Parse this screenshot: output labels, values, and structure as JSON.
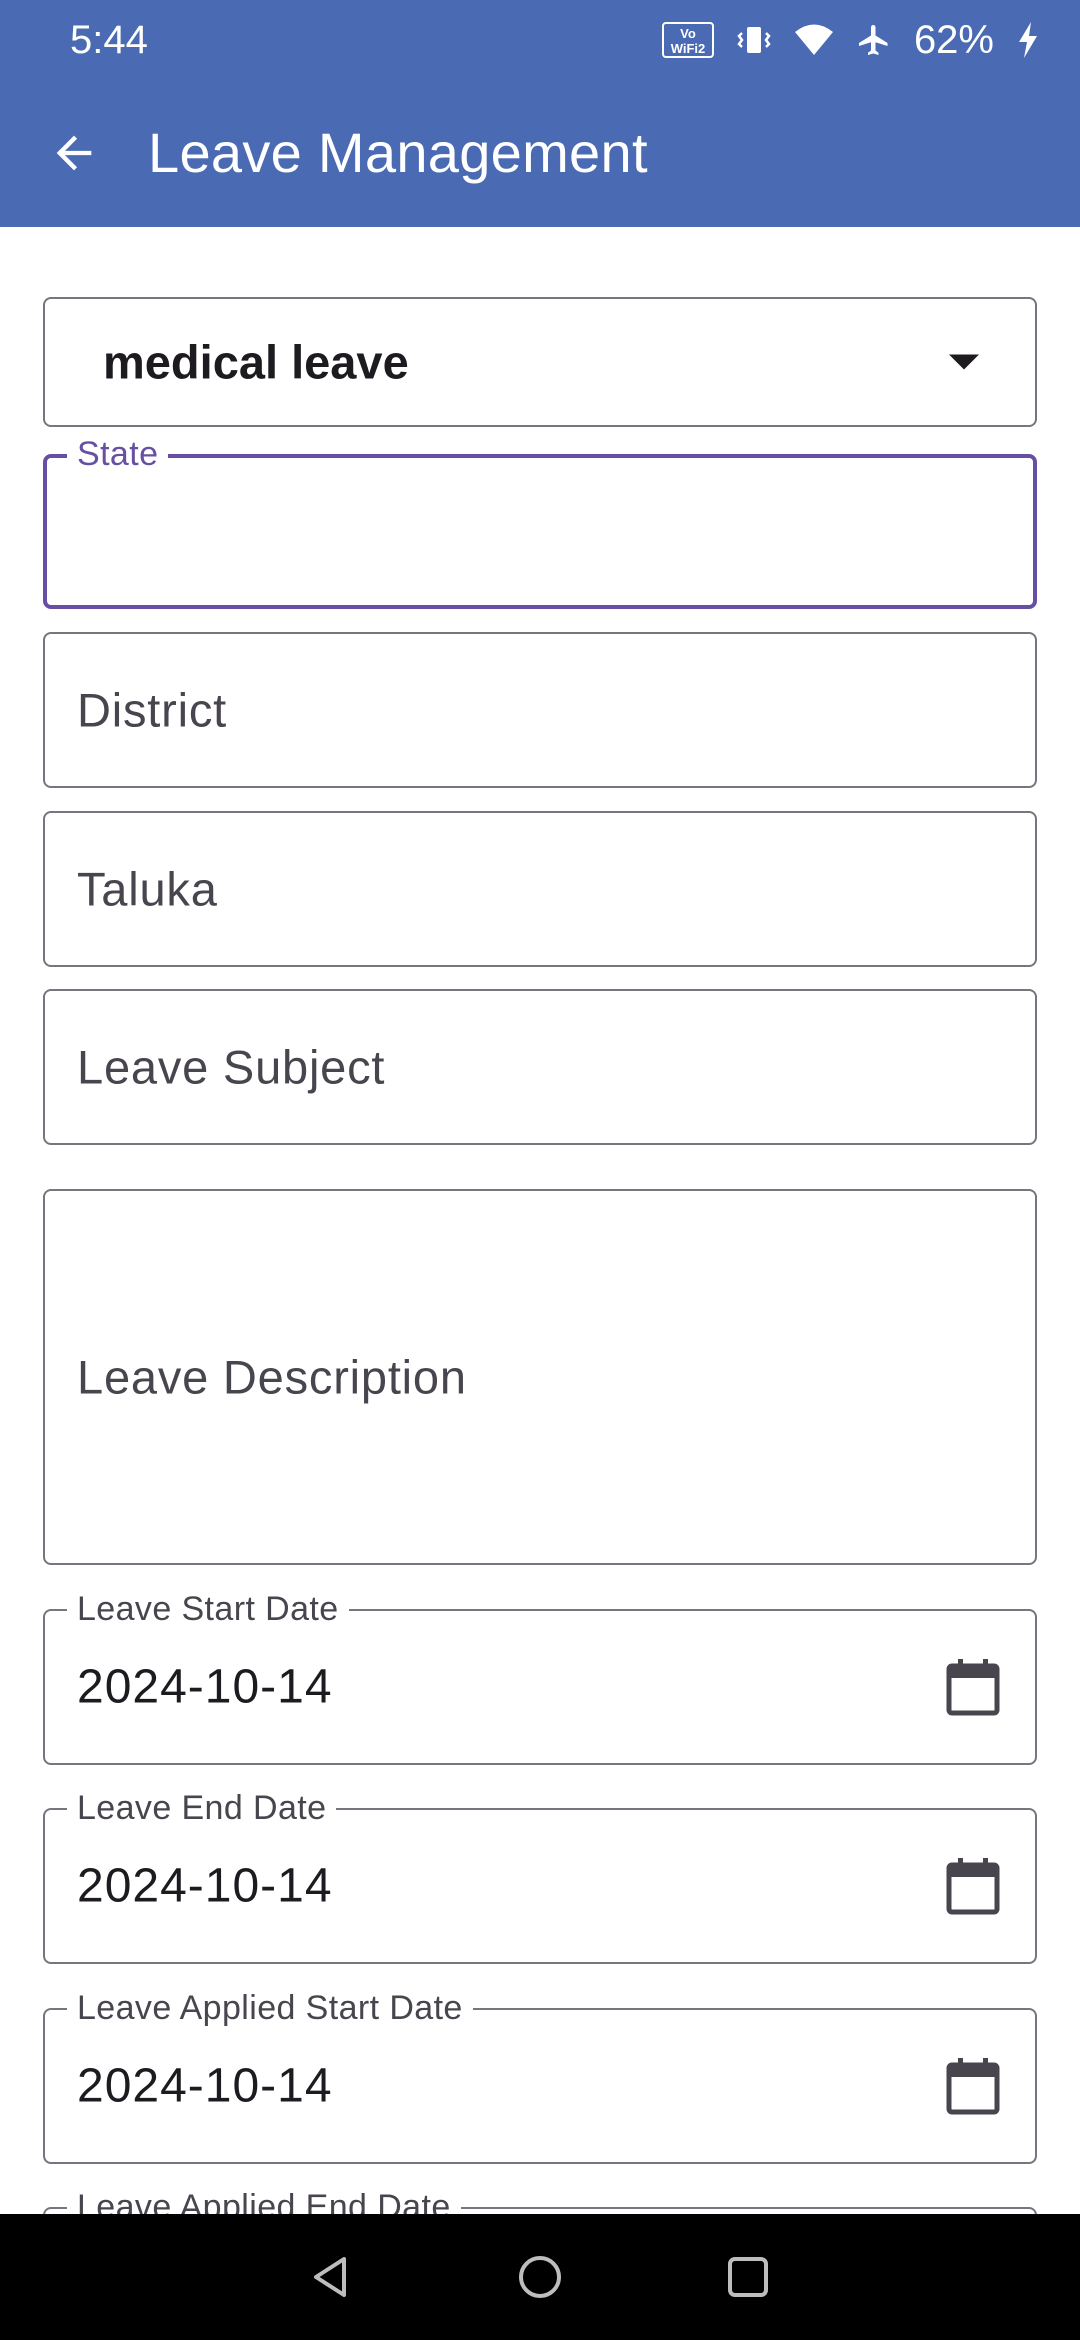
{
  "status_bar": {
    "time": "5:44",
    "battery": "62%",
    "wifi_call_label": "VoWiFi2",
    "icons": [
      "vowifi-icon",
      "vibrate-icon",
      "wifi-icon",
      "airplane-icon",
      "charging-icon"
    ]
  },
  "app_bar": {
    "title": "Leave Management",
    "back_icon": "arrow-left-icon",
    "background_color": "#4a6bb3"
  },
  "form": {
    "leave_type": {
      "value": "medical leave"
    },
    "state": {
      "label": "State",
      "value": ""
    },
    "district": {
      "placeholder": "District"
    },
    "taluka": {
      "placeholder": "Taluka"
    },
    "leave_subject": {
      "placeholder": "Leave Subject"
    },
    "leave_description": {
      "placeholder": "Leave Description"
    },
    "leave_start_date": {
      "label": "Leave Start Date",
      "value": "2024-10-14"
    },
    "leave_end_date": {
      "label": "Leave End Date",
      "value": "2024-10-14"
    },
    "leave_applied_start_date": {
      "label": "Leave Applied Start Date",
      "value": "2024-10-14"
    },
    "leave_applied_end_date": {
      "label": "Leave Applied End Date"
    },
    "focus_color": "#6750a4"
  },
  "nav_bar": {
    "icons": [
      "back-triangle-icon",
      "home-circle-icon",
      "recents-square-icon"
    ]
  }
}
